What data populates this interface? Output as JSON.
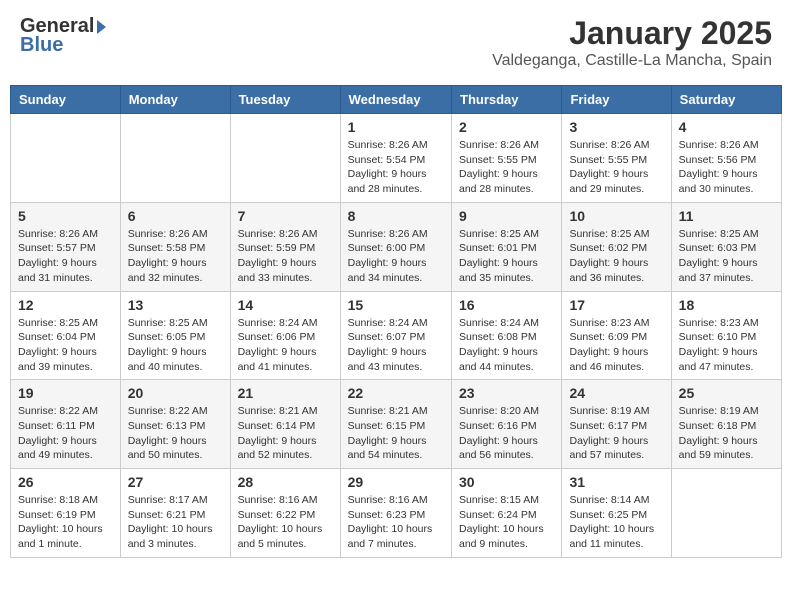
{
  "header": {
    "logo_general": "General",
    "logo_blue": "Blue",
    "month_title": "January 2025",
    "location": "Valdeganga, Castille-La Mancha, Spain"
  },
  "weekdays": [
    "Sunday",
    "Monday",
    "Tuesday",
    "Wednesday",
    "Thursday",
    "Friday",
    "Saturday"
  ],
  "weeks": [
    [
      {
        "day": "",
        "info": ""
      },
      {
        "day": "",
        "info": ""
      },
      {
        "day": "",
        "info": ""
      },
      {
        "day": "1",
        "info": "Sunrise: 8:26 AM\nSunset: 5:54 PM\nDaylight: 9 hours and 28 minutes."
      },
      {
        "day": "2",
        "info": "Sunrise: 8:26 AM\nSunset: 5:55 PM\nDaylight: 9 hours and 28 minutes."
      },
      {
        "day": "3",
        "info": "Sunrise: 8:26 AM\nSunset: 5:55 PM\nDaylight: 9 hours and 29 minutes."
      },
      {
        "day": "4",
        "info": "Sunrise: 8:26 AM\nSunset: 5:56 PM\nDaylight: 9 hours and 30 minutes."
      }
    ],
    [
      {
        "day": "5",
        "info": "Sunrise: 8:26 AM\nSunset: 5:57 PM\nDaylight: 9 hours and 31 minutes."
      },
      {
        "day": "6",
        "info": "Sunrise: 8:26 AM\nSunset: 5:58 PM\nDaylight: 9 hours and 32 minutes."
      },
      {
        "day": "7",
        "info": "Sunrise: 8:26 AM\nSunset: 5:59 PM\nDaylight: 9 hours and 33 minutes."
      },
      {
        "day": "8",
        "info": "Sunrise: 8:26 AM\nSunset: 6:00 PM\nDaylight: 9 hours and 34 minutes."
      },
      {
        "day": "9",
        "info": "Sunrise: 8:25 AM\nSunset: 6:01 PM\nDaylight: 9 hours and 35 minutes."
      },
      {
        "day": "10",
        "info": "Sunrise: 8:25 AM\nSunset: 6:02 PM\nDaylight: 9 hours and 36 minutes."
      },
      {
        "day": "11",
        "info": "Sunrise: 8:25 AM\nSunset: 6:03 PM\nDaylight: 9 hours and 37 minutes."
      }
    ],
    [
      {
        "day": "12",
        "info": "Sunrise: 8:25 AM\nSunset: 6:04 PM\nDaylight: 9 hours and 39 minutes."
      },
      {
        "day": "13",
        "info": "Sunrise: 8:25 AM\nSunset: 6:05 PM\nDaylight: 9 hours and 40 minutes."
      },
      {
        "day": "14",
        "info": "Sunrise: 8:24 AM\nSunset: 6:06 PM\nDaylight: 9 hours and 41 minutes."
      },
      {
        "day": "15",
        "info": "Sunrise: 8:24 AM\nSunset: 6:07 PM\nDaylight: 9 hours and 43 minutes."
      },
      {
        "day": "16",
        "info": "Sunrise: 8:24 AM\nSunset: 6:08 PM\nDaylight: 9 hours and 44 minutes."
      },
      {
        "day": "17",
        "info": "Sunrise: 8:23 AM\nSunset: 6:09 PM\nDaylight: 9 hours and 46 minutes."
      },
      {
        "day": "18",
        "info": "Sunrise: 8:23 AM\nSunset: 6:10 PM\nDaylight: 9 hours and 47 minutes."
      }
    ],
    [
      {
        "day": "19",
        "info": "Sunrise: 8:22 AM\nSunset: 6:11 PM\nDaylight: 9 hours and 49 minutes."
      },
      {
        "day": "20",
        "info": "Sunrise: 8:22 AM\nSunset: 6:13 PM\nDaylight: 9 hours and 50 minutes."
      },
      {
        "day": "21",
        "info": "Sunrise: 8:21 AM\nSunset: 6:14 PM\nDaylight: 9 hours and 52 minutes."
      },
      {
        "day": "22",
        "info": "Sunrise: 8:21 AM\nSunset: 6:15 PM\nDaylight: 9 hours and 54 minutes."
      },
      {
        "day": "23",
        "info": "Sunrise: 8:20 AM\nSunset: 6:16 PM\nDaylight: 9 hours and 56 minutes."
      },
      {
        "day": "24",
        "info": "Sunrise: 8:19 AM\nSunset: 6:17 PM\nDaylight: 9 hours and 57 minutes."
      },
      {
        "day": "25",
        "info": "Sunrise: 8:19 AM\nSunset: 6:18 PM\nDaylight: 9 hours and 59 minutes."
      }
    ],
    [
      {
        "day": "26",
        "info": "Sunrise: 8:18 AM\nSunset: 6:19 PM\nDaylight: 10 hours and 1 minute."
      },
      {
        "day": "27",
        "info": "Sunrise: 8:17 AM\nSunset: 6:21 PM\nDaylight: 10 hours and 3 minutes."
      },
      {
        "day": "28",
        "info": "Sunrise: 8:16 AM\nSunset: 6:22 PM\nDaylight: 10 hours and 5 minutes."
      },
      {
        "day": "29",
        "info": "Sunrise: 8:16 AM\nSunset: 6:23 PM\nDaylight: 10 hours and 7 minutes."
      },
      {
        "day": "30",
        "info": "Sunrise: 8:15 AM\nSunset: 6:24 PM\nDaylight: 10 hours and 9 minutes."
      },
      {
        "day": "31",
        "info": "Sunrise: 8:14 AM\nSunset: 6:25 PM\nDaylight: 10 hours and 11 minutes."
      },
      {
        "day": "",
        "info": ""
      }
    ]
  ]
}
